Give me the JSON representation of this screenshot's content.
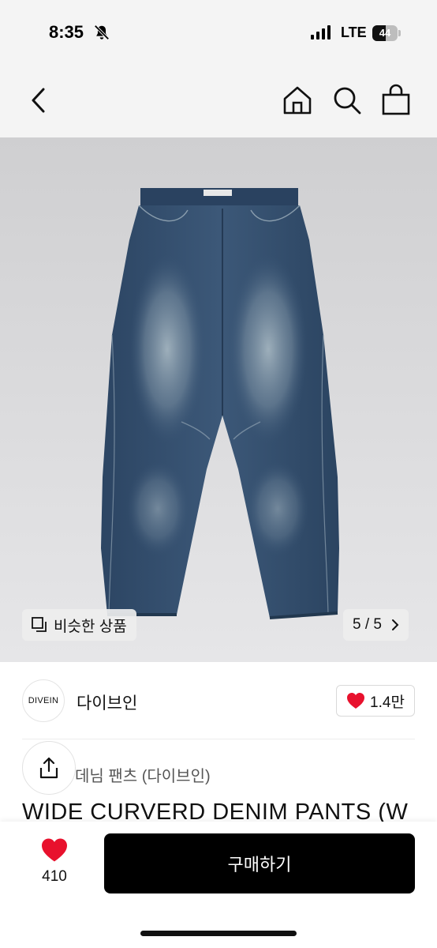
{
  "status_bar": {
    "time": "8:35",
    "network": "LTE",
    "battery": "44"
  },
  "nav": {
    "icons": [
      "back-icon",
      "home-icon",
      "search-icon",
      "shopping-bag-icon"
    ]
  },
  "gallery": {
    "similar_products_label": "비슷한 상품",
    "page_indicator": "5 / 5",
    "image_subject": "wide curved denim pants",
    "current_page": 5,
    "total_pages": 5
  },
  "brand": {
    "logo_text": "DIVEIN",
    "name": "다이브인",
    "likes": "1.4만"
  },
  "product": {
    "category": "데님 팬츠 (다이브인)",
    "title": "WIDE CURVERD DENIM PANTS (W"
  },
  "bottom_bar": {
    "wish_count": "410",
    "buy_label": "구매하기"
  },
  "colors": {
    "accent_heart": "#e8112d",
    "buy_button": "#000000",
    "header_bg": "#f4f4f4"
  }
}
